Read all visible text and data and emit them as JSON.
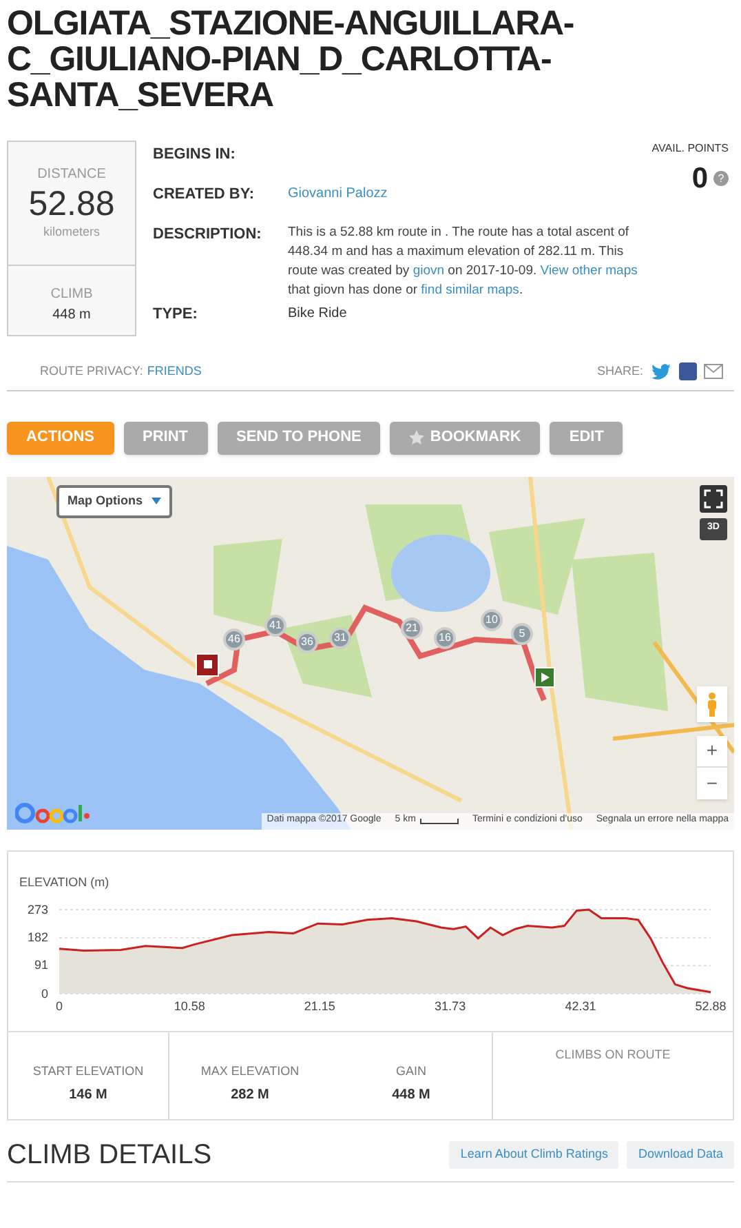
{
  "title": "OLGIATA_STAZIONE-ANGUILLARA-C_GIULIANO-PIAN_D_CARLOTTA-SANTA_SEVERA",
  "summary": {
    "distance_label": "DISTANCE",
    "distance": "52.88",
    "distance_unit": "kilometers",
    "climb_label": "CLIMB",
    "climb": "448 m"
  },
  "details": [
    {
      "kind": "empty",
      "label": "BEGINS IN:"
    },
    {
      "kind": "link",
      "label": "CREATED BY:",
      "value": "Giovanni Palozz"
    },
    {
      "kind": "rich",
      "label": "DESCRIPTION:",
      "parts": [
        {
          "kind": "text",
          "text": "This is a 52.88 km route in . The route has a total ascent of 448.34 m and has a maximum elevation of 282.11 m. This route was created by "
        },
        {
          "kind": "link",
          "text": "giovn"
        },
        {
          "kind": "text",
          "text": " on 2017-10-09. "
        },
        {
          "kind": "link",
          "text": "View other maps"
        },
        {
          "kind": "text",
          "text": " that giovn has done or "
        },
        {
          "kind": "link",
          "text": "find similar maps"
        },
        {
          "kind": "text",
          "text": "."
        }
      ]
    },
    {
      "kind": "text",
      "label": "TYPE:",
      "value": "Bike Ride"
    }
  ],
  "points": {
    "label": "AVAIL. POINTS",
    "value": "0",
    "help": "?"
  },
  "privacy": {
    "label": "ROUTE PRIVACY:",
    "value": "FRIENDS"
  },
  "share": {
    "label": "SHARE:"
  },
  "actions": [
    {
      "label": "ACTIONS",
      "selected": true,
      "kind": "plain"
    },
    {
      "label": "PRINT",
      "selected": false,
      "kind": "plain"
    },
    {
      "label": "SEND TO PHONE",
      "selected": false,
      "kind": "plain"
    },
    {
      "label": "BOOKMARK",
      "selected": false,
      "kind": "star"
    },
    {
      "label": "EDIT",
      "selected": false,
      "kind": "plain"
    }
  ],
  "map": {
    "options": "Map Options",
    "markers": [
      "46",
      "41",
      "36",
      "31",
      "21",
      "16",
      "10",
      "5"
    ],
    "attribution": [
      "Dati mappa ©2017 Google",
      "5 km",
      "Termini e condizioni d'uso",
      "Segnala un errore nella mappa"
    ],
    "zoom_in": "+",
    "zoom_out": "−",
    "view_3d": "3D"
  },
  "elevation": {
    "chart_data": {
      "type": "area",
      "title": "ELEVATION (m)",
      "x": [
        0,
        2,
        5,
        7,
        10,
        11,
        14,
        17,
        19,
        21,
        23,
        25,
        27,
        29,
        31,
        32,
        33,
        34,
        35,
        36,
        37,
        38,
        40,
        41,
        42,
        43,
        44,
        46,
        47,
        48,
        49,
        50,
        51,
        52.88
      ],
      "series": [
        {
          "color": "#cc1f1f",
          "values": [
            146,
            140,
            142,
            155,
            148,
            160,
            190,
            200,
            196,
            228,
            225,
            240,
            245,
            235,
            215,
            210,
            218,
            180,
            215,
            190,
            210,
            220,
            215,
            220,
            270,
            273,
            245,
            245,
            240,
            180,
            100,
            30,
            18,
            5
          ]
        }
      ],
      "xlim": [
        0,
        52.88
      ],
      "ylim": [
        0,
        273
      ],
      "xticks": [
        0,
        10.58,
        21.15,
        31.73,
        42.31,
        52.88
      ],
      "yticks": [
        0,
        91,
        182,
        273
      ]
    }
  },
  "stats": [
    {
      "label": "START ELEVATION",
      "value": "146 M"
    },
    {
      "label": "MAX ELEVATION",
      "value": "282 M"
    },
    {
      "label": "GAIN",
      "value": "448 M"
    }
  ],
  "climbs": {
    "label": "CLIMBS ON ROUTE"
  },
  "climb_details": {
    "title": "CLIMB DETAILS",
    "buttons": [
      "Learn About Climb Ratings",
      "Download Data"
    ]
  }
}
